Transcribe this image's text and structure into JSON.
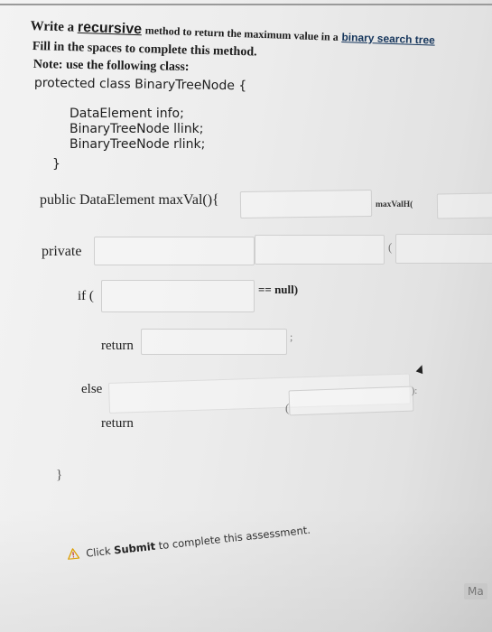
{
  "question": {
    "line1_prefix": "Write a",
    "line1_keyword": "recursive",
    "line1_middle": "method to return the maximum value in a",
    "line1_link": "binary search tree",
    "line2": "Fill in the spaces to complete this method.",
    "line3": "Note: use the following class:",
    "class_decl": "protected class BinaryTreeNode {"
  },
  "class_fields": [
    "DataElement info;",
    "BinaryTreeNode llink;",
    "BinaryTreeNode rlink;"
  ],
  "class_close": "}",
  "method": {
    "public_decl": "public DataElement maxVal(){",
    "helper_call": "maxValH(",
    "private_label": "private",
    "if_label": "if (",
    "null_check": "== null)",
    "return1": "return",
    "else_label": "else",
    "return2": "return",
    "close_brace": "}",
    "paren_open_1": "(",
    "paren_open_2": "(",
    "semicolon": ";",
    "trailing": "):"
  },
  "blanks": {
    "b1": "",
    "b2": "",
    "b3": "",
    "b4": "",
    "b5": "",
    "b6": "",
    "b7": "",
    "b8": "",
    "b9": ""
  },
  "footer": {
    "prefix": "Click",
    "bold": "Submit",
    "suffix": "to complete this assessment."
  },
  "dock_text": "Ma",
  "colors": {
    "warning": "#e0a000",
    "link": "#16365c"
  }
}
